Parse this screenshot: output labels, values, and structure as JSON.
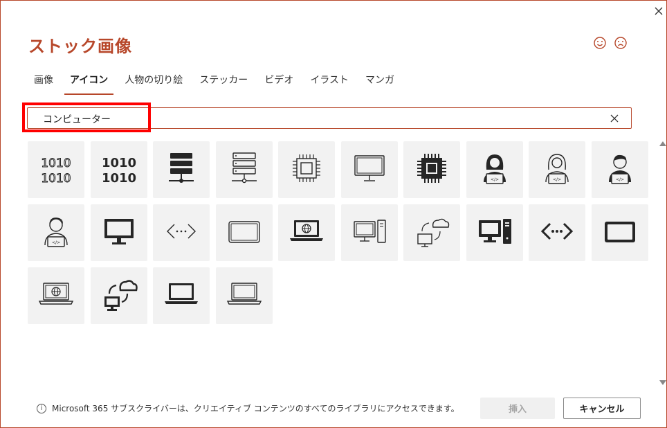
{
  "dialog": {
    "title": "ストック画像",
    "close_icon": "close-icon",
    "feedback": [
      {
        "name": "smile-icon",
        "glyph": "☺"
      },
      {
        "name": "frown-icon",
        "glyph": "☹"
      }
    ]
  },
  "tabs": [
    {
      "label": "画像",
      "active": false
    },
    {
      "label": "アイコン",
      "active": true
    },
    {
      "label": "人物の切り絵",
      "active": false
    },
    {
      "label": "ステッカー",
      "active": false
    },
    {
      "label": "ビデオ",
      "active": false
    },
    {
      "label": "イラスト",
      "active": false
    },
    {
      "label": "マンガ",
      "active": false
    }
  ],
  "search": {
    "value": "コンピューター",
    "clear_icon": "clear-search-icon"
  },
  "icons": [
    "binary-outline-icon",
    "binary-bold-icon",
    "server-stack-bold-icon",
    "server-stack-outline-icon",
    "cpu-chip-outline-icon",
    "monitor-outline-icon",
    "cpu-chip-bold-icon",
    "programmer-woman-bold-icon",
    "programmer-woman-outline-icon",
    "programmer-man-bold-icon",
    "programmer-man-outline-icon",
    "monitor-bold-icon",
    "code-outline-icon",
    "tablet-outline-icon",
    "laptop-globe-bold-icon",
    "desktop-tower-outline-icon",
    "cloud-sync-outline-icon",
    "desktop-tower-bold-icon",
    "code-bold-icon",
    "tablet-bold-icon",
    "laptop-globe-outline-icon",
    "cloud-sync-bold-icon",
    "laptop-bold-icon",
    "laptop-outline-icon"
  ],
  "footer": {
    "info_text": "Microsoft 365 サブスクライバーは、クリエイティブ コンテンツのすべてのライブラリにアクセスできます。",
    "insert_label": "挿入",
    "cancel_label": "キャンセル"
  },
  "colors": {
    "accent": "#b7472a",
    "highlight": "#ff0000",
    "tile_bg": "#f2f2f2"
  }
}
